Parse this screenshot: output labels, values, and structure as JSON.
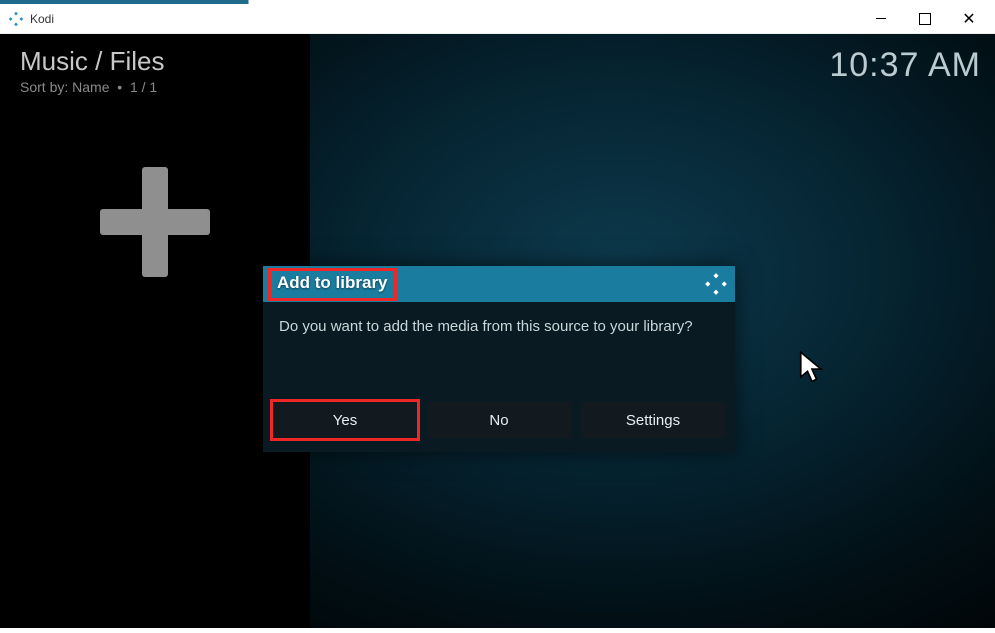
{
  "window": {
    "title": "Kodi"
  },
  "header": {
    "breadcrumb": "Music / Files",
    "sort_prefix": "Sort by: Name",
    "position": "1 / 1",
    "clock": "10:37 AM"
  },
  "dialog": {
    "title": "Add to library",
    "message": "Do you want to add the media from this source to your library?",
    "buttons": {
      "yes": "Yes",
      "no": "No",
      "settings": "Settings"
    }
  }
}
